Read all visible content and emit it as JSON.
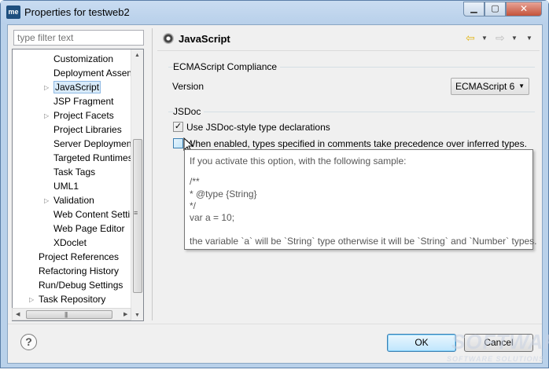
{
  "window": {
    "title": "Properties for testweb2",
    "app_icon_text": "me",
    "minimize_glyph": "▁",
    "maximize_glyph": "▢",
    "close_glyph": "✕"
  },
  "filter": {
    "placeholder": "type filter text"
  },
  "tree": {
    "items": [
      {
        "label": "Customization",
        "indent": 2,
        "expandable": false,
        "selected": false
      },
      {
        "label": "Deployment Assembly",
        "indent": 2,
        "expandable": false,
        "selected": false
      },
      {
        "label": "JavaScript",
        "indent": 2,
        "expandable": true,
        "selected": true
      },
      {
        "label": "JSP Fragment",
        "indent": 2,
        "expandable": false,
        "selected": false
      },
      {
        "label": "Project Facets",
        "indent": 2,
        "expandable": true,
        "selected": false
      },
      {
        "label": "Project Libraries",
        "indent": 2,
        "expandable": false,
        "selected": false
      },
      {
        "label": "Server Deployment",
        "indent": 2,
        "expandable": false,
        "selected": false
      },
      {
        "label": "Targeted Runtimes",
        "indent": 2,
        "expandable": false,
        "selected": false
      },
      {
        "label": "Task Tags",
        "indent": 2,
        "expandable": false,
        "selected": false
      },
      {
        "label": "UML1",
        "indent": 2,
        "expandable": false,
        "selected": false
      },
      {
        "label": "Validation",
        "indent": 2,
        "expandable": true,
        "selected": false
      },
      {
        "label": "Web Content Settings",
        "indent": 2,
        "expandable": false,
        "selected": false
      },
      {
        "label": "Web Page Editor",
        "indent": 2,
        "expandable": false,
        "selected": false
      },
      {
        "label": "XDoclet",
        "indent": 2,
        "expandable": false,
        "selected": false
      },
      {
        "label": "Project References",
        "indent": 1,
        "expandable": false,
        "selected": false
      },
      {
        "label": "Refactoring History",
        "indent": 1,
        "expandable": false,
        "selected": false
      },
      {
        "label": "Run/Debug Settings",
        "indent": 1,
        "expandable": false,
        "selected": false
      },
      {
        "label": "Task Repository",
        "indent": 1,
        "expandable": true,
        "selected": false
      }
    ]
  },
  "page": {
    "title": "JavaScript",
    "nav_back_glyph": "⇦",
    "nav_forward_glyph": "⇨",
    "dropdown_glyph": "▼"
  },
  "ecmascript": {
    "group_title": "ECMAScript Compliance",
    "version_label": "Version",
    "version_value": "ECMAScript 6"
  },
  "jsdoc": {
    "group_title": "JSDoc",
    "checkbox1_label": "Use JSDoc-style type declarations",
    "checkbox1_checked": true,
    "checkbox2_label": "When enabled, types specified in comments take precedence over inferred types.",
    "checkbox2_checked": false
  },
  "tooltip": {
    "lines": [
      "If you activate this option, with the following sample:",
      "",
      "/**",
      " * @type {String}",
      " */",
      " var a = 10;",
      "",
      " the variable `a` will be `String` type otherwise it will be `String` and `Number` types."
    ]
  },
  "buttons": {
    "help": "?",
    "ok": "OK",
    "cancel": "Cancel"
  },
  "watermark": {
    "big": "SOFTWARE",
    "small": "SOFTWARE SOLUTIONS"
  },
  "colors": {
    "accent": "#3c7fb1",
    "selection": "#d9ebfa",
    "frame": "#b9d1ea"
  }
}
